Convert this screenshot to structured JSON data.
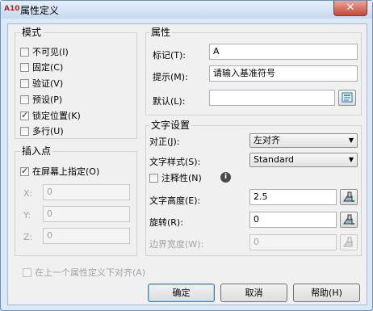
{
  "window": {
    "title": "属性定义",
    "app_icon_text": "A10",
    "close_glyph": "✕"
  },
  "mode": {
    "title": "模式",
    "items": [
      {
        "label": "不可见(I)",
        "checked": false
      },
      {
        "label": "固定(C)",
        "checked": false
      },
      {
        "label": "验证(V)",
        "checked": false
      },
      {
        "label": "预设(P)",
        "checked": false
      },
      {
        "label": "锁定位置(K)",
        "checked": true
      },
      {
        "label": "多行(U)",
        "checked": false
      }
    ]
  },
  "insert_point": {
    "title": "插入点",
    "specify_on_screen": {
      "label": "在屏幕上指定(O)",
      "checked": true
    },
    "x": {
      "label": "X:",
      "value": "0"
    },
    "y": {
      "label": "Y:",
      "value": "0"
    },
    "z": {
      "label": "Z:",
      "value": "0"
    }
  },
  "attribute": {
    "title": "属性",
    "tag": {
      "label": "标记(T):",
      "value": "A"
    },
    "prompt": {
      "label": "提示(M):",
      "value": "请输入基准符号"
    },
    "default": {
      "label": "默认(L):",
      "value": ""
    }
  },
  "text_settings": {
    "title": "文字设置",
    "justify": {
      "label": "对正(J):",
      "value": "左对齐"
    },
    "style": {
      "label": "文字样式(S):",
      "value": "Standard"
    },
    "annotative": {
      "label": "注释性(N)",
      "checked": false,
      "info_glyph": "i"
    },
    "height": {
      "label": "文字高度(E):",
      "value": "2.5"
    },
    "rotation": {
      "label": "旋转(R):",
      "value": "0"
    },
    "boundary_width": {
      "label": "边界宽度(W):",
      "value": "0"
    }
  },
  "align_below": {
    "label": "在上一个属性定义下对齐(A)",
    "checked": false
  },
  "buttons": {
    "ok": "确定",
    "cancel": "取消",
    "help": "帮助(H)"
  },
  "colors": {
    "title_bar": "#c6d9ee",
    "close": "#c4473a",
    "client_bg": "#f0f0f0"
  }
}
